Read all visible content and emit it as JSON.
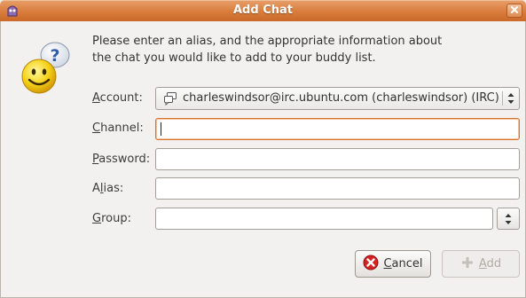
{
  "window": {
    "title": "Add Chat"
  },
  "prompt": {
    "line1": "Please enter an alias, and the appropriate information about",
    "line2": "the chat you would like to add to your buddy list."
  },
  "fields": {
    "account": {
      "mn": "A",
      "rest": "ccount:",
      "value": "charleswindsor@irc.ubuntu.com (charleswindsor) (IRC)"
    },
    "channel": {
      "mn": "C",
      "rest": "hannel:",
      "value": ""
    },
    "password": {
      "mn": "P",
      "rest": "assword:",
      "value": ""
    },
    "alias": {
      "pre": "A",
      "mn": "l",
      "rest": "ias:",
      "value": ""
    },
    "group": {
      "mn": "G",
      "rest": "roup:",
      "value": ""
    }
  },
  "buttons": {
    "cancel": {
      "mn": "C",
      "rest": "ancel"
    },
    "add": {
      "mn": "A",
      "rest": "dd"
    }
  },
  "icons": {
    "app": "pidgin-icon",
    "close": "close-icon",
    "dialog": "smiley-question-icon",
    "account": "chat-bubble-icon",
    "cancel": "cancel-icon",
    "add": "plus-icon"
  },
  "colors": {
    "titlebar": "#d97c3c",
    "focus": "#d9742e"
  }
}
